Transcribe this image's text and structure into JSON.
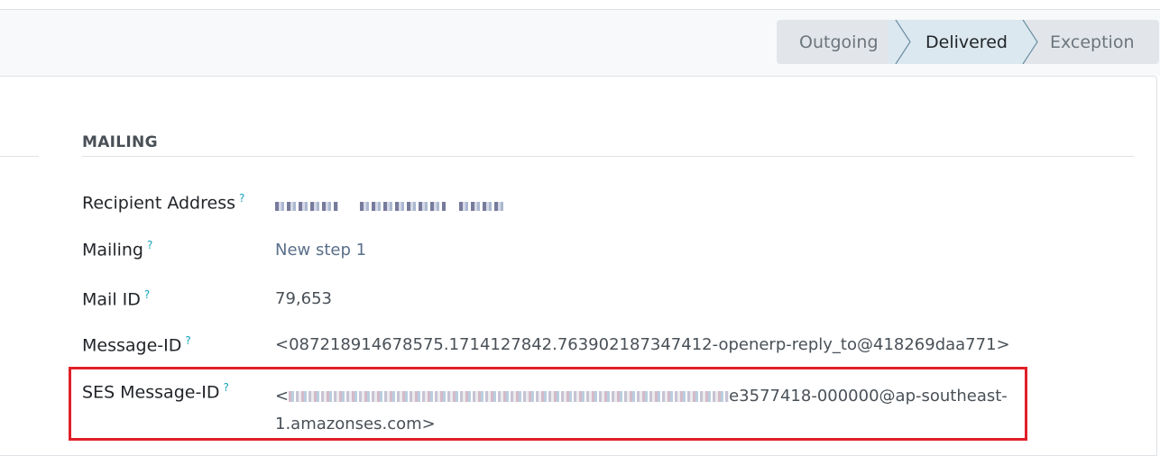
{
  "statusbar": {
    "stages": [
      {
        "label": "Outgoing",
        "active": false
      },
      {
        "label": "Delivered",
        "active": true
      },
      {
        "label": "Exception",
        "active": false
      }
    ]
  },
  "section": {
    "title": "MAILING"
  },
  "help_glyph": "?",
  "fields": {
    "recipient_address": {
      "label": "Recipient Address"
    },
    "mailing": {
      "label": "Mailing",
      "value": "New step 1"
    },
    "mail_id": {
      "label": "Mail ID",
      "value": "79,653"
    },
    "message_id": {
      "label": "Message-ID",
      "value": "<087218914678575.1714127842.763902187347412-openerp-reply_to@418269daa771>"
    },
    "ses_message_id": {
      "label": "SES Message-ID",
      "value_prefix": "<",
      "value_line1_suffix": "e3577418-000000@ap-southeast-",
      "value_line2": "1.amazonses.com>"
    }
  },
  "colors": {
    "highlight_border": "#e02028",
    "help_icon": "#17a2b8",
    "link": "#5a6f8a",
    "active_stage_bg": "#dbe8ef"
  }
}
